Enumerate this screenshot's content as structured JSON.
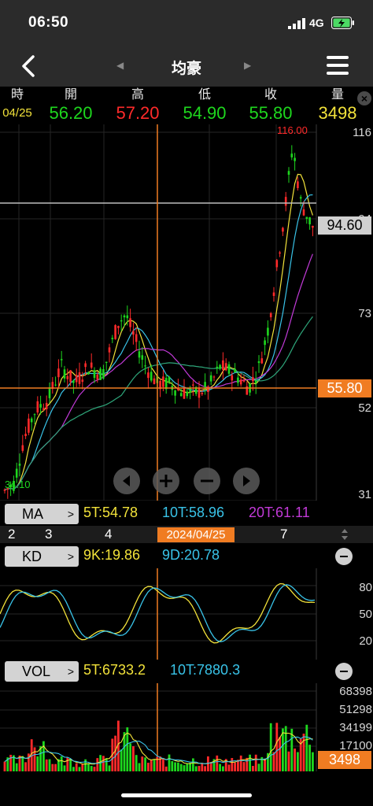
{
  "status": {
    "time": "06:50",
    "network": "4G"
  },
  "nav": {
    "title": "均豪",
    "prev": "◀",
    "next": "▶"
  },
  "quote": {
    "labels": [
      "時",
      "開",
      "高",
      "低",
      "收",
      "量"
    ],
    "date": "04/25",
    "open": "56.20",
    "high": "57.20",
    "low": "54.90",
    "close": "55.80",
    "volume": "3498"
  },
  "main_chart": {
    "y_ticks": [
      "116",
      "94",
      "73",
      "52",
      "31"
    ],
    "high_label": "116.00",
    "low_label": "34.10",
    "crosshair_tag": "94.60",
    "close_tag": "55.80",
    "ylim": [
      31,
      116
    ]
  },
  "ma": {
    "button": "MA",
    "ma5": "5T:54.78",
    "ma10": "10T:58.96",
    "ma20": "20T:61.11"
  },
  "dates": {
    "months": [
      "2",
      "3",
      "4",
      "7"
    ],
    "selected": "2024/04/25"
  },
  "kd": {
    "button": "KD",
    "k": "9K:19.86",
    "d": "9D:20.78",
    "y_ticks": [
      "80",
      "50",
      "20"
    ]
  },
  "vol": {
    "button": "VOL",
    "ma5": "5T:6733.2",
    "ma10": "10T:7880.3",
    "y_ticks": [
      "68398",
      "51298",
      "34199",
      "17100"
    ],
    "current": "3498"
  },
  "colors": {
    "up": "#ff2a2a",
    "down": "#1ed71e",
    "ma5": "#f2e23a",
    "ma10": "#39c3e8",
    "ma20": "#c23ad8",
    "ma60": "#2ea67a",
    "crosshair": "#f07c22"
  }
}
